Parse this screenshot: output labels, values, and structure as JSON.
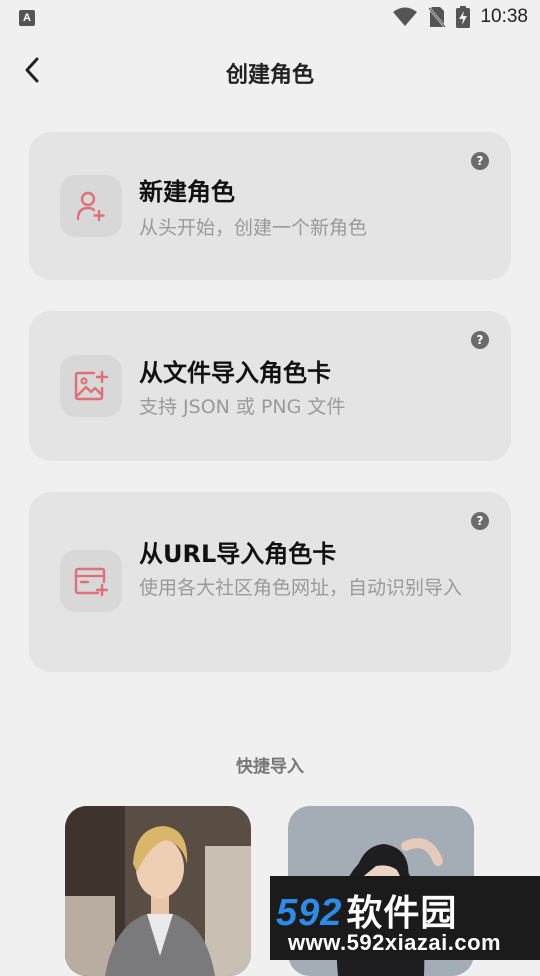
{
  "status_bar": {
    "time": "10:38",
    "app_badge": "A"
  },
  "header": {
    "title": "创建角色"
  },
  "options": [
    {
      "title": "新建角色",
      "description": "从头开始，创建一个新角色",
      "icon": "user-plus-icon",
      "help": "?"
    },
    {
      "title": "从文件导入角色卡",
      "description": "支持 JSON 或 PNG 文件",
      "icon": "image-plus-icon",
      "help": "?"
    },
    {
      "title": "从URL导入角色卡",
      "description": "使用各大社区角色网址，自动识别导入",
      "icon": "browser-plus-icon",
      "help": "?"
    }
  ],
  "quick_import": {
    "label": "快捷导入"
  },
  "watermark": {
    "brand_num": "592",
    "brand_cn": "软件园",
    "url": "www.592xiazai.com"
  },
  "colors": {
    "accent": "#e07078",
    "card_bg": "#e4e4e4",
    "page_bg": "#f0f0f0"
  }
}
